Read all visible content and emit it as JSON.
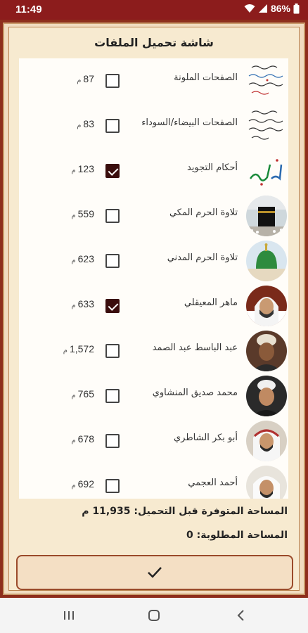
{
  "status": {
    "time": "11:49",
    "battery": "86%"
  },
  "title": "شاشة تحميل الملفات",
  "items": [
    {
      "label": "الصفحات الملونة",
      "size": "87",
      "unit": "م",
      "checked": false,
      "icon": "colored-pages-thumbnail"
    },
    {
      "label": "الصفحات البيضاء/السوداء",
      "size": "83",
      "unit": "م",
      "checked": false,
      "icon": "bw-pages-thumbnail"
    },
    {
      "label": "أحكام التجويد",
      "size": "123",
      "unit": "م",
      "checked": true,
      "icon": "tajweed-calligraphy-thumbnail"
    },
    {
      "label": "تلاوة الحرم المكي",
      "size": "559",
      "unit": "م",
      "checked": false,
      "icon": "kaaba-thumbnail"
    },
    {
      "label": "تلاوة الحرم المدني",
      "size": "623",
      "unit": "م",
      "checked": false,
      "icon": "green-dome-thumbnail"
    },
    {
      "label": "ماهر المعيقلي",
      "size": "633",
      "unit": "م",
      "checked": true,
      "icon": "reciter-photo"
    },
    {
      "label": "عبد الباسط عبد الصمد",
      "size": "1,572",
      "unit": "م",
      "checked": false,
      "icon": "reciter-photo"
    },
    {
      "label": "محمد صديق المنشاوي",
      "size": "765",
      "unit": "م",
      "checked": false,
      "icon": "reciter-photo"
    },
    {
      "label": "أبو بكر الشاطري",
      "size": "678",
      "unit": "م",
      "checked": false,
      "icon": "reciter-photo"
    },
    {
      "label": "أحمد العجمي",
      "size": "692",
      "unit": "م",
      "checked": false,
      "icon": "reciter-photo"
    }
  ],
  "available_space": "المساحة المتوفرة قبل التحميل: 11,935 م",
  "required_space": "المساحة المطلوبة: 0",
  "confirm_icon": "checkmark-icon",
  "colors": {
    "status_bar": "#8c1c1c",
    "frame": "#8e2e1c",
    "panel": "#f7ead0",
    "checkbox_checked": "#3a0d0d"
  }
}
